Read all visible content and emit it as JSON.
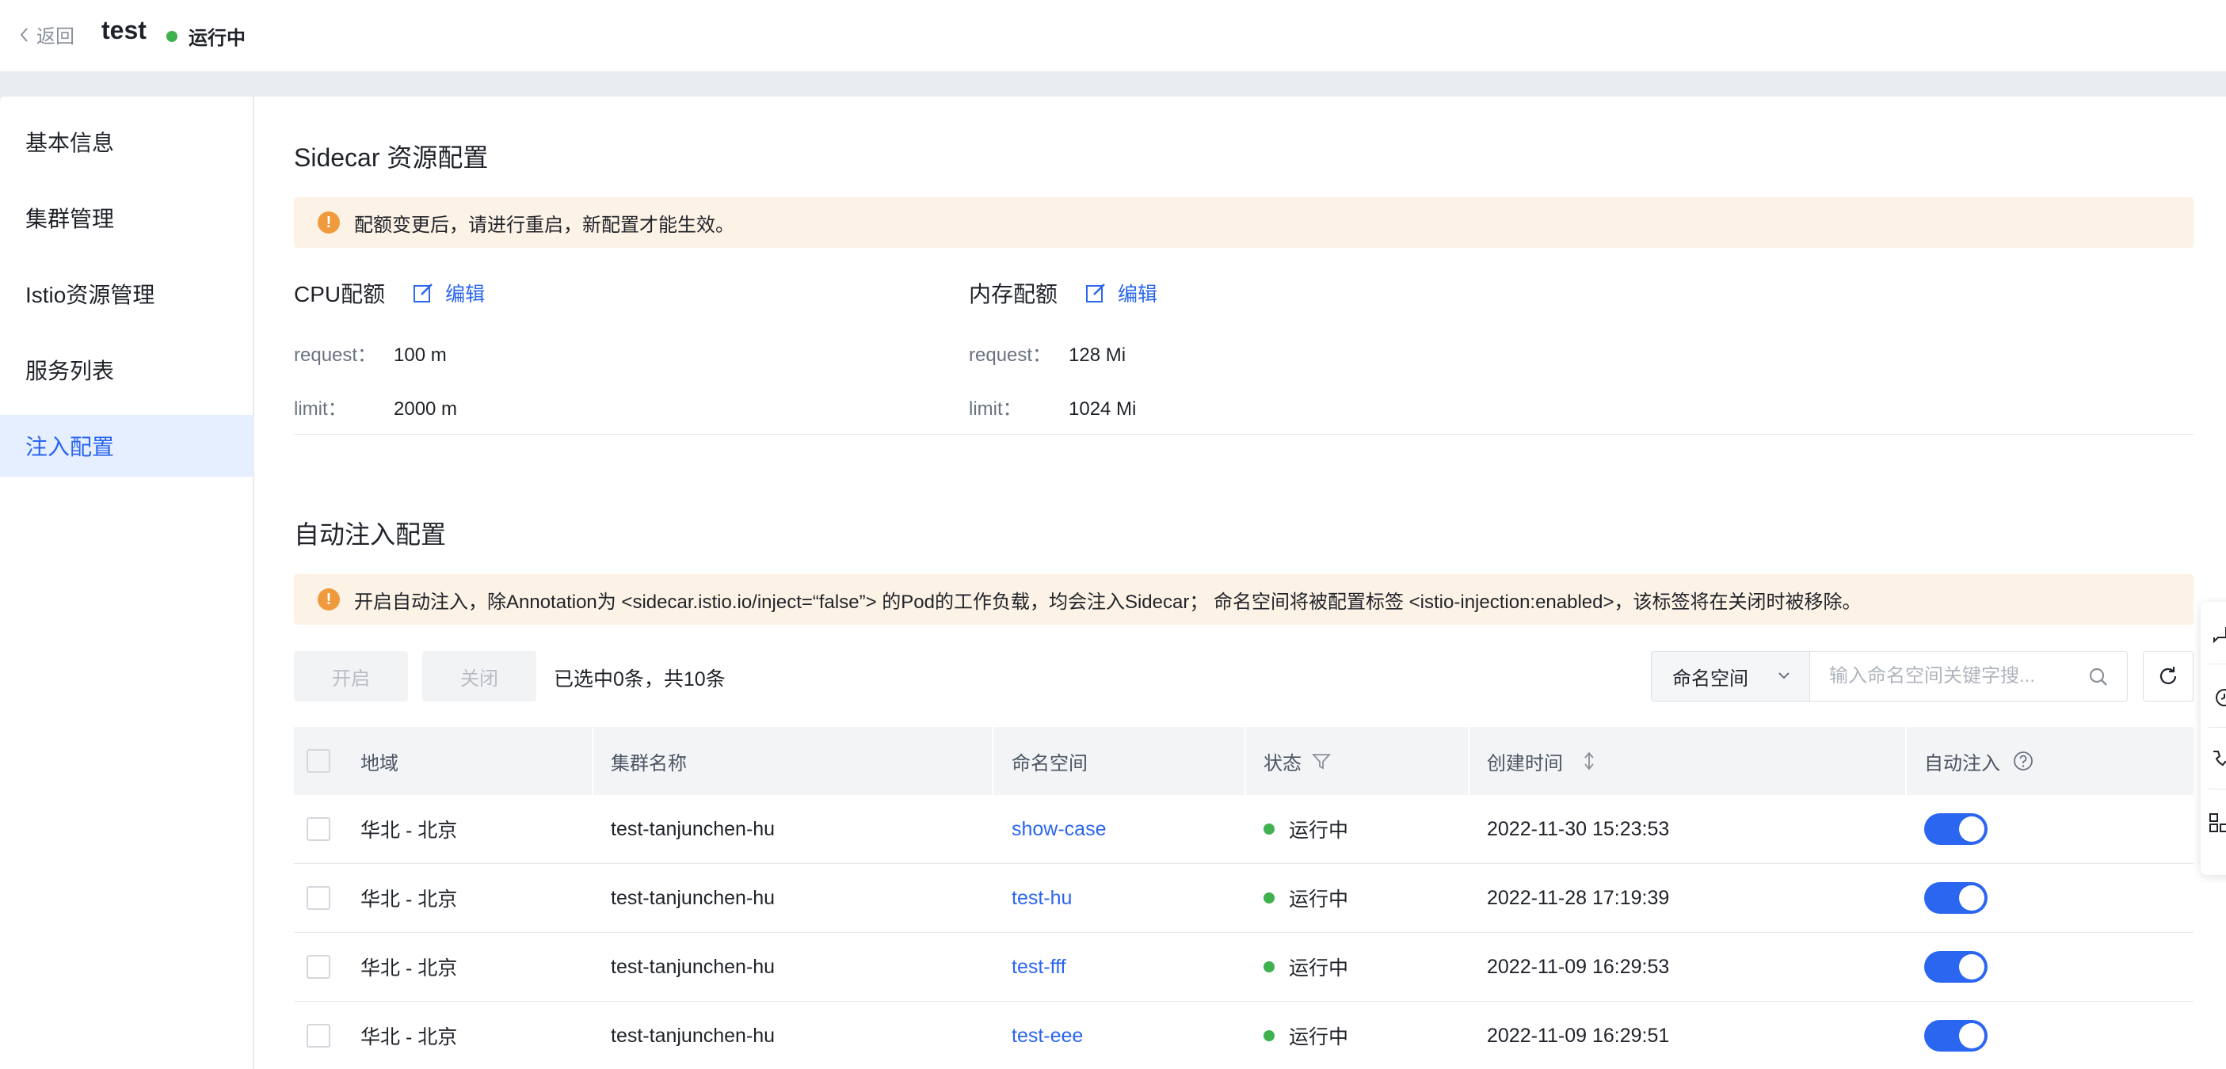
{
  "header": {
    "back_label": "返回",
    "title": "test",
    "status": "运行中",
    "status_color": "#3fb14e"
  },
  "sidebar": {
    "items": [
      {
        "label": "基本信息"
      },
      {
        "label": "集群管理"
      },
      {
        "label": "Istio资源管理"
      },
      {
        "label": "服务列表"
      },
      {
        "label": "注入配置",
        "active": true
      }
    ]
  },
  "sidecar": {
    "title": "Sidecar 资源配置",
    "alert": "配额变更后，请进行重启，新配置才能生效。",
    "cpu": {
      "title": "CPU配额",
      "edit_label": "编辑",
      "request_label": "request：",
      "request_value": "100 m",
      "limit_label": "limit：",
      "limit_value": "2000 m"
    },
    "memory": {
      "title": "内存配额",
      "edit_label": "编辑",
      "request_label": "request：",
      "request_value": "128 Mi",
      "limit_label": "limit：",
      "limit_value": "1024 Mi"
    }
  },
  "auto_inject": {
    "title": "自动注入配置",
    "alert": "开启自动注入，除Annotation为 <sidecar.istio.io/inject=“false”> 的Pod的工作负载，均会注入Sidecar； 命名空间将被配置标签 <istio-injection:enabled>，该标签将在关闭时被移除。",
    "enable_label": "开启",
    "disable_label": "关闭",
    "selection_text": "已选中0条，共10条",
    "filter_select": "命名空间",
    "search_placeholder": "输入命名空间关键字搜..."
  },
  "table": {
    "columns": {
      "region": "地域",
      "cluster": "集群名称",
      "namespace": "命名空间",
      "status": "状态",
      "created": "创建时间",
      "auto_inject": "自动注入"
    },
    "rows": [
      {
        "region": "华北 - 北京",
        "cluster": "test-tanjunchen-hu",
        "namespace": "show-case",
        "status": "运行中",
        "created": "2022-11-30 15:23:53",
        "auto_inject": true
      },
      {
        "region": "华北 - 北京",
        "cluster": "test-tanjunchen-hu",
        "namespace": "test-hu",
        "status": "运行中",
        "created": "2022-11-28 17:19:39",
        "auto_inject": true
      },
      {
        "region": "华北 - 北京",
        "cluster": "test-tanjunchen-hu",
        "namespace": "test-fff",
        "status": "运行中",
        "created": "2022-11-09 16:29:53",
        "auto_inject": true
      },
      {
        "region": "华北 - 北京",
        "cluster": "test-tanjunchen-hu",
        "namespace": "test-eee",
        "status": "运行中",
        "created": "2022-11-09 16:29:51",
        "auto_inject": true
      }
    ]
  },
  "colors": {
    "primary": "#2a66f0",
    "warning": "#f09a3e",
    "alert_bg": "#fdf2e6",
    "running": "#3fb14e"
  }
}
